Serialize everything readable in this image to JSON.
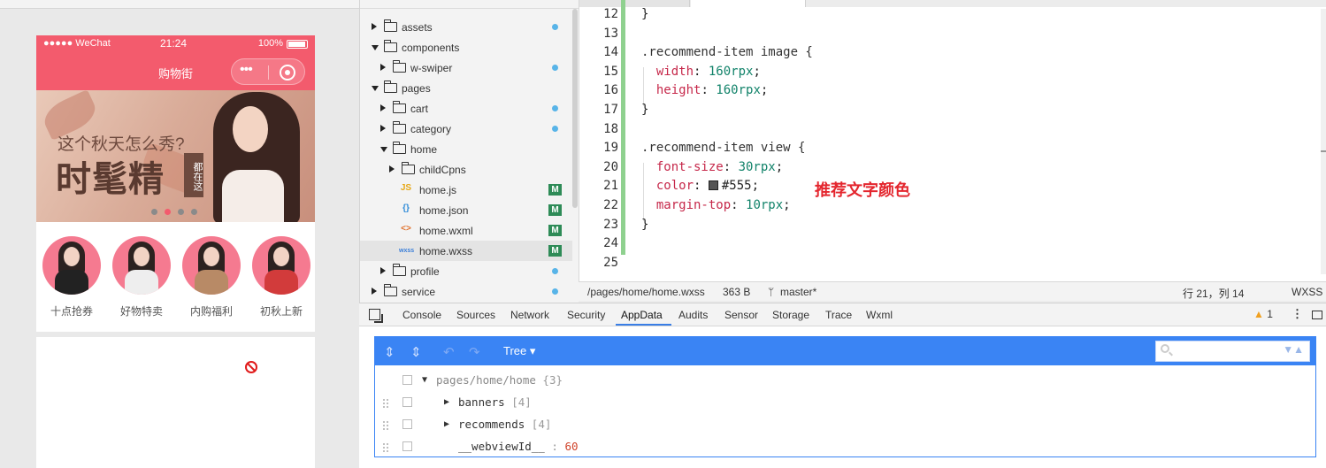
{
  "simulator": {
    "status_left": "●●●●● WeChat",
    "status_time": "21:24",
    "status_battery": "100%",
    "nav_title": "购物街",
    "capsule_dots": "•••",
    "banner_line1": "这个秋天怎么秀?",
    "banner_line2": "时髦精",
    "banner_tag": "都在这",
    "banner_dots": 4,
    "banner_active_dot": 2,
    "recommends": [
      {
        "label": "十点抢券",
        "outfit": "#222222"
      },
      {
        "label": "好物特卖",
        "outfit": "#eeeeee"
      },
      {
        "label": "内购福利",
        "outfit": "#b88a66"
      },
      {
        "label": "初秋上新",
        "outfit": "#d23b3b"
      }
    ]
  },
  "explorer": {
    "items": [
      {
        "label": "assets",
        "type": "folder",
        "expanded": false,
        "level": 0,
        "mark": "dot"
      },
      {
        "label": "components",
        "type": "folder",
        "expanded": true,
        "level": 0,
        "mark": "none"
      },
      {
        "label": "w-swiper",
        "type": "folder",
        "expanded": false,
        "level": 1,
        "mark": "dot"
      },
      {
        "label": "pages",
        "type": "folder",
        "expanded": true,
        "level": 0,
        "mark": "none"
      },
      {
        "label": "cart",
        "type": "folder",
        "expanded": false,
        "level": 1,
        "mark": "dot"
      },
      {
        "label": "category",
        "type": "folder",
        "expanded": false,
        "level": 1,
        "mark": "dot"
      },
      {
        "label": "home",
        "type": "folder",
        "expanded": true,
        "level": 1,
        "mark": "none"
      },
      {
        "label": "childCpns",
        "type": "folder",
        "expanded": false,
        "level": 2,
        "mark": "none"
      },
      {
        "label": "home.js",
        "type": "js",
        "icon": "JS",
        "level": 2,
        "mark": "M"
      },
      {
        "label": "home.json",
        "type": "json",
        "icon": "{}",
        "level": 2,
        "mark": "M"
      },
      {
        "label": "home.wxml",
        "type": "wxml",
        "icon": "<>",
        "level": 2,
        "mark": "M"
      },
      {
        "label": "home.wxss",
        "type": "wxss",
        "icon": "wxss",
        "level": 2,
        "mark": "M",
        "selected": true
      },
      {
        "label": "profile",
        "type": "folder",
        "expanded": false,
        "level": 1,
        "mark": "dot"
      },
      {
        "label": "service",
        "type": "folder",
        "expanded": false,
        "level": 0,
        "mark": "dot"
      }
    ]
  },
  "editor": {
    "lines": [
      {
        "n": "12",
        "html": "}"
      },
      {
        "n": "13",
        "html": ""
      },
      {
        "n": "14",
        "html": "<span class=\"k-sel\">.recommend-item image {</span>"
      },
      {
        "n": "15",
        "html": "  <span class=\"k-prop\">width</span>: <span class=\"k-num\">160rpx</span>;"
      },
      {
        "n": "16",
        "html": "  <span class=\"k-prop\">height</span>: <span class=\"k-num\">160rpx</span>;"
      },
      {
        "n": "17",
        "html": "}"
      },
      {
        "n": "18",
        "html": ""
      },
      {
        "n": "19",
        "html": "<span class=\"k-sel\">.recommend-item view {</span>"
      },
      {
        "n": "20",
        "html": "  <span class=\"k-prop\">font-size</span>: <span class=\"k-num\">30rpx</span>;"
      },
      {
        "n": "21",
        "html": "  <span class=\"k-prop\">color</span>: <span class=\"swatch\"></span><span class=\"k-hex\">#555</span>;"
      },
      {
        "n": "22",
        "html": "  <span class=\"k-prop\">margin-top</span>: <span class=\"k-num\">10rpx</span>;"
      },
      {
        "n": "23",
        "html": "}"
      },
      {
        "n": "24",
        "html": ""
      },
      {
        "n": "25",
        "html": ""
      }
    ],
    "annotation": "推荐文字颜色",
    "status": {
      "path": "/pages/home/home.wxss",
      "size": "363 B",
      "branch": "master*",
      "position": "行 21，列 14",
      "lang": "WXSS"
    }
  },
  "devtools": {
    "tabs": [
      "Console",
      "Sources",
      "Network",
      "Security",
      "AppData",
      "Audits",
      "Sensor",
      "Storage",
      "Trace",
      "Wxml"
    ],
    "active_tab": "AppData",
    "warning_count": "1",
    "mode": "Tree",
    "tree": [
      {
        "key": "pages/home/home",
        "meta": "{3}",
        "indent": 0,
        "toggle": "▼"
      },
      {
        "key": "banners",
        "meta": "[4]",
        "indent": 1,
        "toggle": "▶"
      },
      {
        "key": "recommends",
        "meta": "[4]",
        "indent": 1,
        "toggle": "▶"
      },
      {
        "key": "__webviewId__",
        "value": "60",
        "indent": 1,
        "toggle": ""
      }
    ]
  },
  "colors": {
    "brand_pink": "#f35b6d",
    "devtools_blue": "#3a84f4",
    "git_modified": "#2e8b57",
    "annotation_red": "#e4262e"
  }
}
